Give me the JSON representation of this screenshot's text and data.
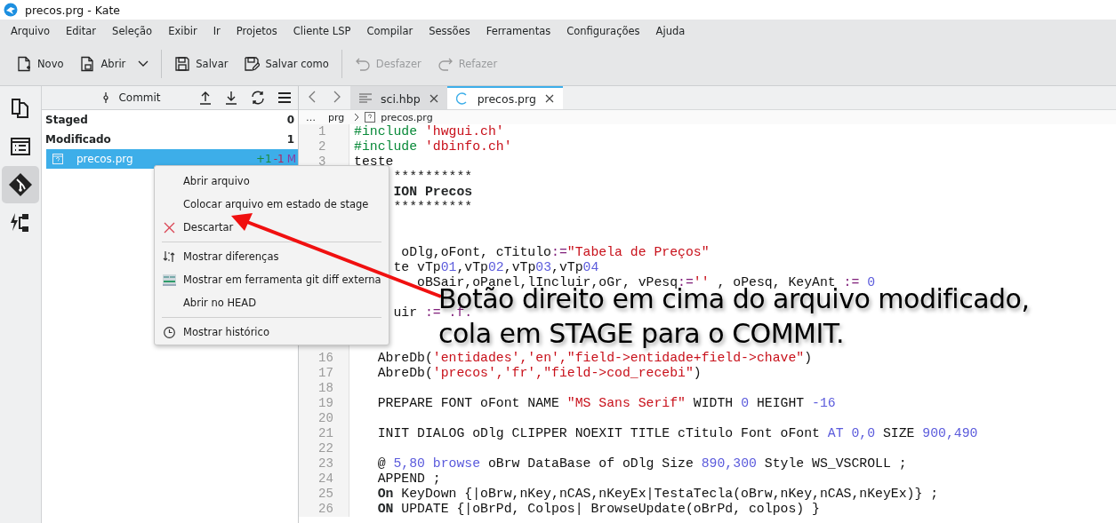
{
  "window": {
    "title": "precos.prg  - Kate"
  },
  "menubar": [
    "Arquivo",
    "Editar",
    "Seleção",
    "Exibir",
    "Ir",
    "Projetos",
    "Cliente LSP",
    "Compilar",
    "Sessões",
    "Ferramentas",
    "Configurações",
    "Ajuda"
  ],
  "toolbar": [
    {
      "kind": "new",
      "label": "Novo",
      "disabled": false
    },
    {
      "kind": "open",
      "label": "Abrir",
      "disabled": false
    },
    {
      "kind": "save",
      "label": "Salvar",
      "disabled": false
    },
    {
      "kind": "saveas",
      "label": "Salvar como",
      "disabled": false
    },
    {
      "kind": "undo",
      "label": "Desfazer",
      "disabled": true
    },
    {
      "kind": "redo",
      "label": "Refazer",
      "disabled": true
    }
  ],
  "sidebar": [
    {
      "kind": "documents",
      "selected": false
    },
    {
      "kind": "list",
      "selected": false
    },
    {
      "kind": "git",
      "selected": true
    },
    {
      "kind": "tree",
      "selected": false
    }
  ],
  "git_panel": {
    "title": "Commit",
    "sections": [
      {
        "label": "Staged",
        "count": "0"
      },
      {
        "label": "Modificado",
        "count": "1"
      }
    ],
    "files": [
      {
        "name": "precos.prg",
        "added": "+1",
        "removed": "-1",
        "status": "M",
        "selected": true
      }
    ]
  },
  "tabs": [
    {
      "label": "sci.hbp",
      "selected": false
    },
    {
      "label": "precos.prg",
      "selected": true
    }
  ],
  "breadcrumb": [
    "…",
    "prg",
    "precos.prg"
  ],
  "code": [
    {
      "n": "1",
      "segs": [
        {
          "kind": "pre",
          "text": "#include"
        },
        {
          "kind": "str",
          "text": " 'hwgui.ch'"
        }
      ]
    },
    {
      "n": "2",
      "segs": [
        {
          "kind": "pre",
          "text": "#include"
        },
        {
          "kind": "str",
          "text": " 'dbinfo.ch'"
        }
      ]
    },
    {
      "n": "3",
      "segs": [
        {
          "kind": "plain",
          "text": "teste"
        }
      ]
    },
    {
      "segs": [
        {
          "kind": "plain",
          "text": "     **********"
        }
      ]
    },
    {
      "segs": [
        {
          "kind": "bold",
          "text": "     ION Precos"
        }
      ]
    },
    {
      "segs": [
        {
          "kind": "plain",
          "text": "     **********"
        }
      ]
    },
    {
      "kind": "blank"
    },
    {
      "kind": "blank"
    },
    {
      "segs": [
        {
          "kind": "plain",
          "text": "      oDlg,oFont, cTitulo"
        },
        {
          "kind": "op",
          "text": ":="
        },
        {
          "kind": "str",
          "text": "\"Tabela de Preços\""
        }
      ]
    },
    {
      "segs": [
        {
          "kind": "plain",
          "text": "     te vTp"
        },
        {
          "kind": "num",
          "text": "01"
        },
        {
          "kind": "plain",
          "text": ",vTp"
        },
        {
          "kind": "num",
          "text": "02"
        },
        {
          "kind": "plain",
          "text": ",vTp"
        },
        {
          "kind": "num",
          "text": "03"
        },
        {
          "kind": "plain",
          "text": ",vTp"
        },
        {
          "kind": "num",
          "text": "04"
        }
      ]
    },
    {
      "segs": [
        {
          "kind": "plain",
          "text": "        oBSair,oPanel,lIncluir,oGr, vPesq"
        },
        {
          "kind": "op",
          "text": ":="
        },
        {
          "kind": "str",
          "text": "''"
        },
        {
          "kind": "plain",
          "text": " , oPesq, KeyAnt "
        },
        {
          "kind": "op",
          "text": ":="
        },
        {
          "kind": "num",
          "text": " 0"
        }
      ]
    },
    {
      "kind": "blank"
    },
    {
      "segs": [
        {
          "kind": "plain",
          "text": "     uir "
        },
        {
          "kind": "op",
          "text": ":= .f."
        }
      ]
    },
    {
      "kind": "blank"
    },
    {
      "kind": "blank"
    },
    {
      "n": "16",
      "segs": [
        {
          "kind": "plain",
          "text": "   AbreDb("
        },
        {
          "kind": "str",
          "text": "'entidades','en',\"field->entidade+field->chave\""
        },
        {
          "kind": "plain",
          "text": ")"
        }
      ]
    },
    {
      "n": "17",
      "segs": [
        {
          "kind": "plain",
          "text": "   AbreDb("
        },
        {
          "kind": "str",
          "text": "'precos','fr',\"field->cod_recebi\""
        },
        {
          "kind": "plain",
          "text": ")"
        }
      ]
    },
    {
      "n": "18"
    },
    {
      "n": "19",
      "segs": [
        {
          "kind": "plain",
          "text": "   PREPARE FONT oFont NAME "
        },
        {
          "kind": "str",
          "text": "\"MS Sans Serif\""
        },
        {
          "kind": "plain",
          "text": " WIDTH "
        },
        {
          "kind": "num",
          "text": "0"
        },
        {
          "kind": "plain",
          "text": " HEIGHT "
        },
        {
          "kind": "num",
          "text": "-16"
        }
      ]
    },
    {
      "n": "20"
    },
    {
      "n": "21",
      "segs": [
        {
          "kind": "plain",
          "text": "   INIT DIALOG oDlg CLIPPER NOEXIT TITLE cTitulo Font oFont "
        },
        {
          "kind": "num",
          "text": "AT 0,0"
        },
        {
          "kind": "plain",
          "text": " SIZE "
        },
        {
          "kind": "num",
          "text": "900,490"
        }
      ]
    },
    {
      "n": "22"
    },
    {
      "n": "23",
      "segs": [
        {
          "kind": "plain",
          "text": "   @ "
        },
        {
          "kind": "num",
          "text": "5,80 browse"
        },
        {
          "kind": "plain",
          "text": " oBrw DataBase of oDlg Size "
        },
        {
          "kind": "num",
          "text": "890,300"
        },
        {
          "kind": "plain",
          "text": " Style WS_VSCROLL ;"
        }
      ]
    },
    {
      "n": "24",
      "segs": [
        {
          "kind": "plain",
          "text": "   APPEND ;"
        }
      ]
    },
    {
      "n": "25",
      "segs": [
        {
          "kind": "bold",
          "text": "   On"
        },
        {
          "kind": "plain",
          "text": " KeyDown {|oBrw,nKey,nCAS,nKeyEx|TestaTecla(oBrw,nKey,nCAS,nKeyEx)} ;"
        }
      ]
    },
    {
      "n": "26",
      "segs": [
        {
          "kind": "bold",
          "text": "   ON"
        },
        {
          "kind": "plain",
          "text": " UPDATE {|oBrPd, Colpos| BrowseUpdate(oBrPd, colpos) }"
        }
      ]
    }
  ],
  "context_menu": [
    {
      "kind": "plain",
      "label": "Abrir arquivo"
    },
    {
      "kind": "plain",
      "label": "Colocar arquivo em estado de stage"
    },
    {
      "kind": "discard",
      "label": "Descartar"
    },
    {
      "kind": "separator"
    },
    {
      "kind": "diff",
      "label": "Mostrar diferenças"
    },
    {
      "kind": "external",
      "label": "Mostrar em ferramenta git diff externa"
    },
    {
      "kind": "plain",
      "label": "Abrir no HEAD"
    },
    {
      "kind": "separator"
    },
    {
      "kind": "history",
      "label": "Mostrar histórico"
    }
  ],
  "annotation": [
    "Botão direito em cima do arquivo modificado,",
    "cola em STAGE para o COMMIT."
  ]
}
